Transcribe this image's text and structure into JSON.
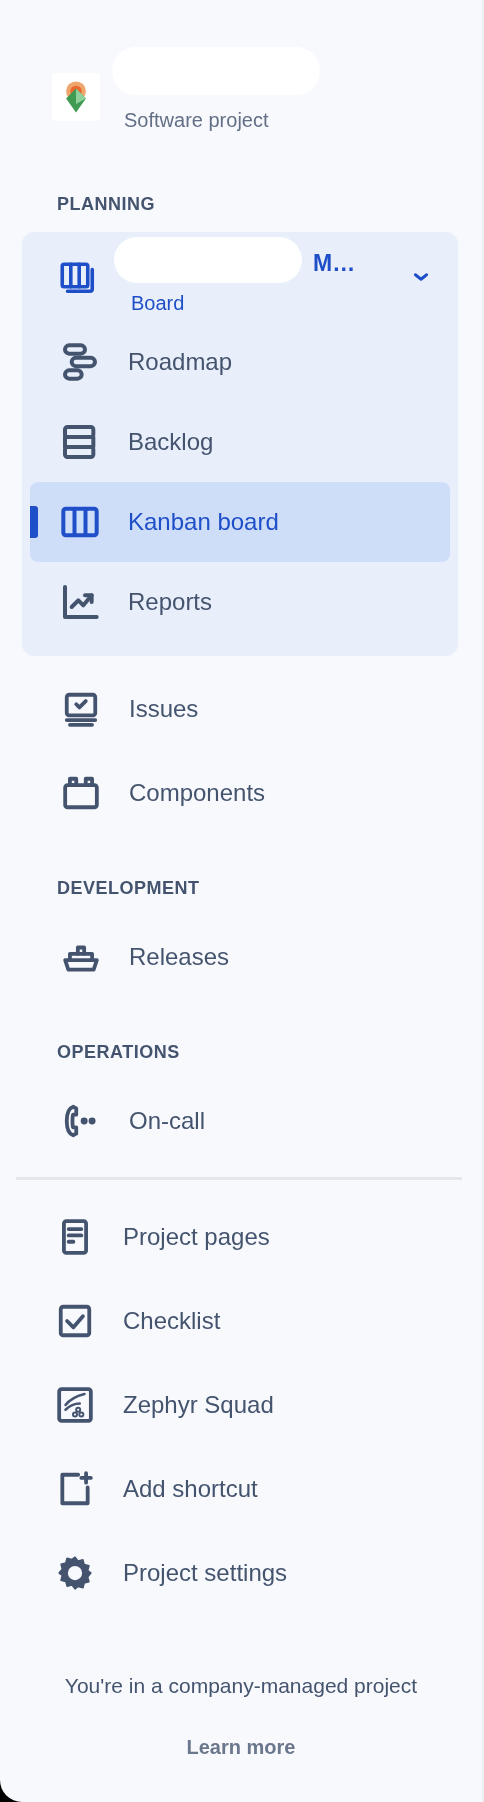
{
  "project": {
    "type": "Software project"
  },
  "sections": [
    {
      "heading": "PLANNING",
      "group": {
        "title": "M…",
        "subtitle": "Board",
        "expanded": true,
        "items": [
          {
            "label": "Roadmap",
            "kind": "roadmap",
            "selected": false
          },
          {
            "label": "Backlog",
            "kind": "backlog",
            "selected": false
          },
          {
            "label": "Kanban board",
            "kind": "board",
            "selected": true
          },
          {
            "label": "Reports",
            "kind": "reports",
            "selected": false
          }
        ]
      },
      "items": [
        {
          "label": "Issues",
          "kind": "issues"
        },
        {
          "label": "Components",
          "kind": "components"
        }
      ]
    },
    {
      "heading": "DEVELOPMENT",
      "items": [
        {
          "label": "Releases",
          "kind": "releases"
        }
      ]
    },
    {
      "heading": "OPERATIONS",
      "items": [
        {
          "label": "On-call",
          "kind": "oncall"
        }
      ]
    }
  ],
  "shortcuts": [
    {
      "label": "Project pages",
      "kind": "pages"
    },
    {
      "label": "Checklist",
      "kind": "checklist"
    },
    {
      "label": "Zephyr Squad",
      "kind": "zephyr"
    },
    {
      "label": "Add shortcut",
      "kind": "add"
    },
    {
      "label": "Project settings",
      "kind": "settings"
    }
  ],
  "footer": {
    "text": "You're in a company-managed project",
    "link": "Learn more"
  }
}
